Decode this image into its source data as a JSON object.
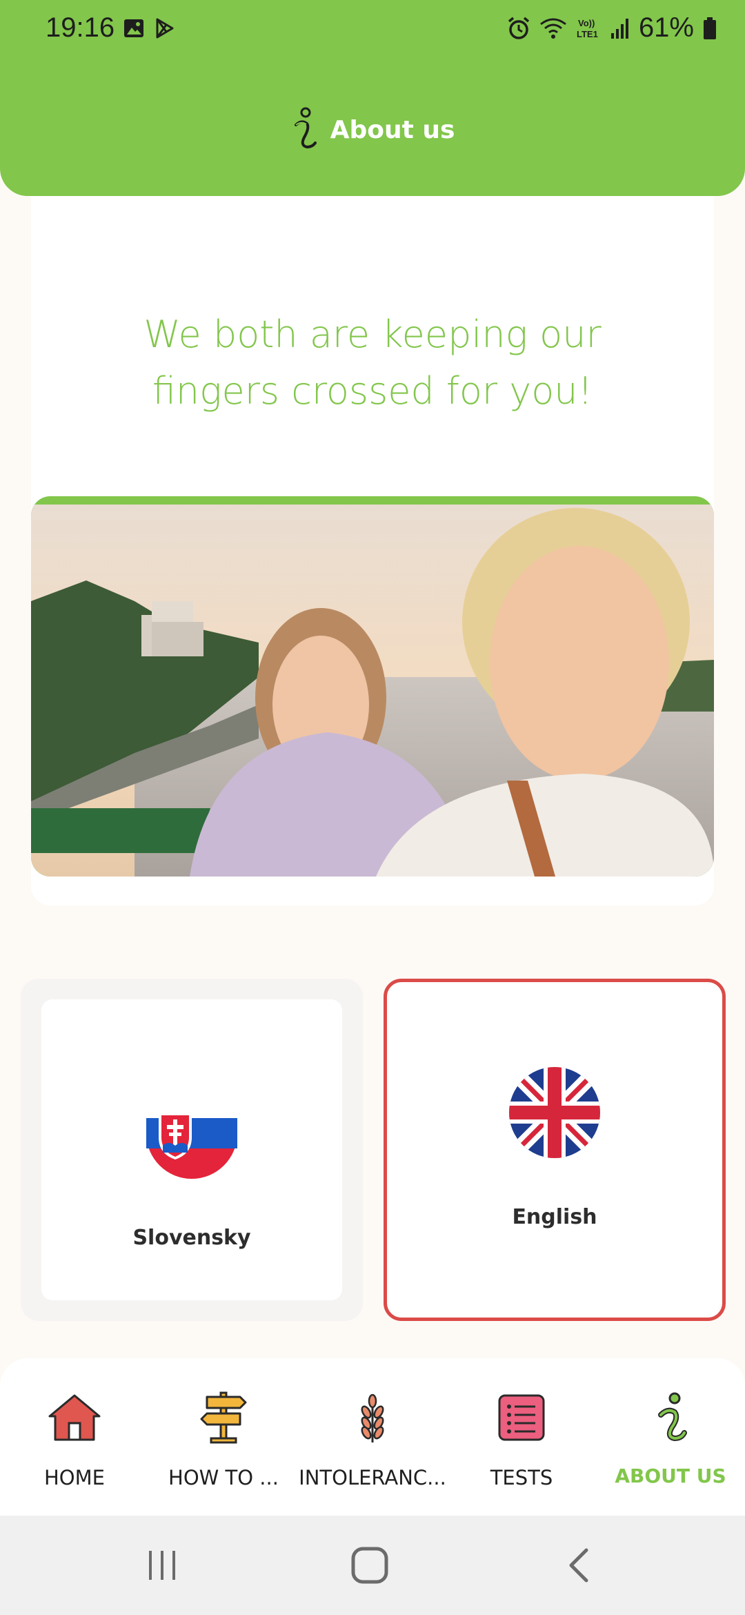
{
  "status_bar": {
    "time": "19:16",
    "battery": "61%",
    "icons_left": [
      "image-icon",
      "play-store-icon"
    ],
    "icons_right": [
      "alarm-icon",
      "wifi-icon",
      "volte-icon",
      "signal-icon",
      "battery-icon"
    ]
  },
  "header": {
    "title": "About us",
    "icon": "info-icon"
  },
  "content": {
    "tagline_line1": "We both are keeping our",
    "tagline_line2": "fingers crossed for you!"
  },
  "languages": [
    {
      "label": "Slovensky",
      "flag": "slovak-flag-icon",
      "selected": false
    },
    {
      "label": "English",
      "flag": "uk-flag-icon",
      "selected": true
    }
  ],
  "bottom_nav": {
    "items": [
      {
        "label": "HOME",
        "icon": "home-icon",
        "active": false
      },
      {
        "label": "HOW TO ...",
        "icon": "signpost-icon",
        "active": false
      },
      {
        "label": "INTOLERANC...",
        "icon": "wheat-icon",
        "active": false
      },
      {
        "label": "TESTS",
        "icon": "checklist-icon",
        "active": false
      },
      {
        "label": "ABOUT US",
        "icon": "info-icon",
        "active": true
      }
    ]
  },
  "colors": {
    "brand_green": "#82c64b",
    "selected_border": "#db4b48",
    "home_red": "#e0574f",
    "signpost_yellow": "#f2b63c",
    "wheat_orange": "#e98b6a",
    "tests_pink": "#ec5f7f"
  }
}
